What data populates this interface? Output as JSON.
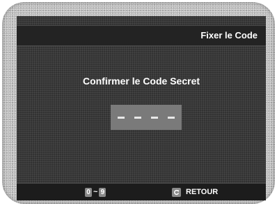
{
  "header": {
    "title": "Fixer le Code"
  },
  "dialog": {
    "prompt": "Confirmer le Code Secret",
    "code_placeholder": "– – – –"
  },
  "footer": {
    "key_start": "0",
    "key_separator": "~",
    "key_end": "9",
    "return_icon": "return-arrow-icon",
    "return_label": "RETOUR"
  }
}
